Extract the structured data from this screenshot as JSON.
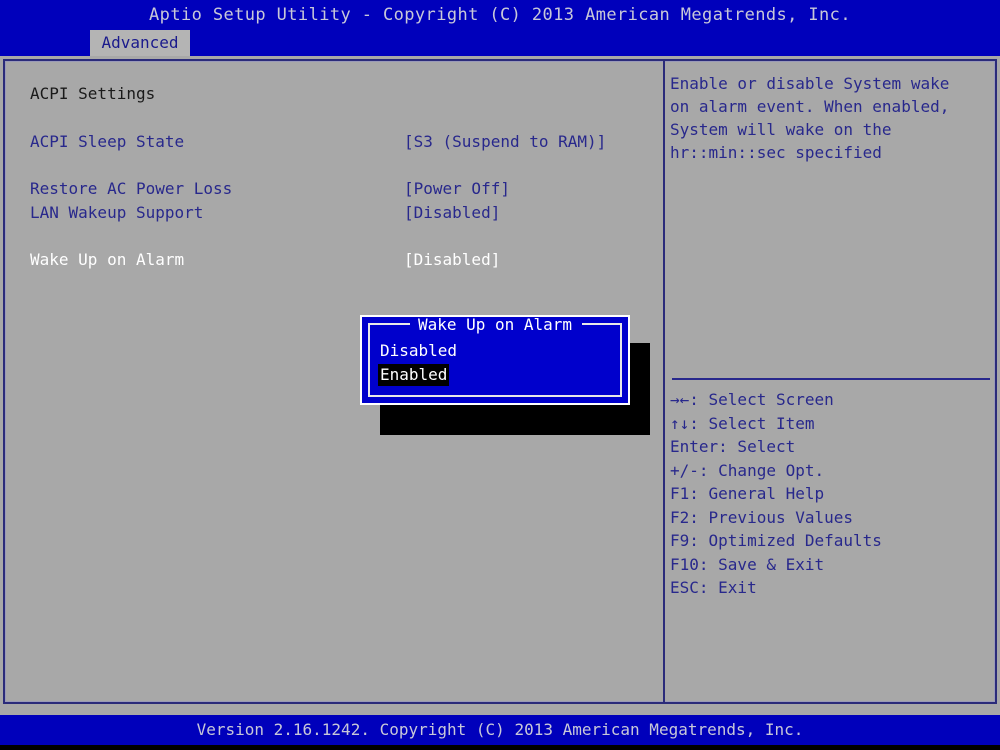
{
  "window": {
    "title": "Aptio Setup Utility - Copyright (C) 2013 American Megatrends, Inc.",
    "footer": "Version 2.16.1242. Copyright (C) 2013 American Megatrends, Inc."
  },
  "menubar": {
    "tabs": [
      {
        "label": "Advanced",
        "active": true
      }
    ]
  },
  "settings": {
    "heading": "ACPI Settings",
    "rows": [
      {
        "label": "ACPI Sleep State",
        "value": "[S3 (Suspend to RAM)]",
        "selected": false
      },
      {
        "label": "Restore AC Power Loss",
        "value": "[Power Off]",
        "selected": false
      },
      {
        "label": "LAN Wakeup Support",
        "value": "[Disabled]",
        "selected": false
      },
      {
        "label": "Wake Up on Alarm",
        "value": "[Disabled]",
        "selected": true
      }
    ]
  },
  "help": {
    "lines": [
      "Enable or disable System wake",
      "on alarm event. When enabled,",
      "System will wake on the",
      "hr::min::sec specified"
    ]
  },
  "legend": {
    "keys": [
      "→←: Select Screen",
      "↑↓: Select Item",
      "Enter: Select",
      "+/-: Change Opt.",
      "F1: General Help",
      "F2: Previous Values",
      "F9: Optimized Defaults",
      "F10: Save & Exit",
      "ESC: Exit"
    ]
  },
  "dialog": {
    "title": "Wake Up on Alarm",
    "options": [
      {
        "label": "Disabled",
        "highlighted": false
      },
      {
        "label": "Enabled",
        "highlighted": true
      }
    ]
  },
  "colors": {
    "bios_blue": "#0000bb",
    "panel_gray": "#a8a8a8",
    "item_navy": "#28288c",
    "selected_white": "#ffffff",
    "dialog_blue": "#0000cc",
    "highlight_black": "#000000"
  }
}
